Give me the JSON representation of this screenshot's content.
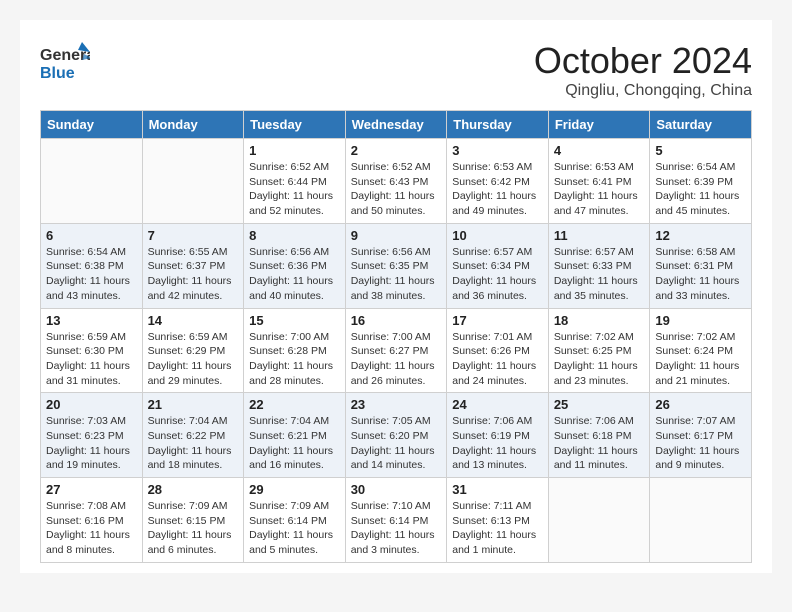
{
  "header": {
    "logo_general": "General",
    "logo_blue": "Blue",
    "month": "October 2024",
    "location": "Qingliu, Chongqing, China"
  },
  "weekdays": [
    "Sunday",
    "Monday",
    "Tuesday",
    "Wednesday",
    "Thursday",
    "Friday",
    "Saturday"
  ],
  "weeks": [
    [
      {
        "day": "",
        "info": ""
      },
      {
        "day": "",
        "info": ""
      },
      {
        "day": "1",
        "info": "Sunrise: 6:52 AM\nSunset: 6:44 PM\nDaylight: 11 hours and 52 minutes."
      },
      {
        "day": "2",
        "info": "Sunrise: 6:52 AM\nSunset: 6:43 PM\nDaylight: 11 hours and 50 minutes."
      },
      {
        "day": "3",
        "info": "Sunrise: 6:53 AM\nSunset: 6:42 PM\nDaylight: 11 hours and 49 minutes."
      },
      {
        "day": "4",
        "info": "Sunrise: 6:53 AM\nSunset: 6:41 PM\nDaylight: 11 hours and 47 minutes."
      },
      {
        "day": "5",
        "info": "Sunrise: 6:54 AM\nSunset: 6:39 PM\nDaylight: 11 hours and 45 minutes."
      }
    ],
    [
      {
        "day": "6",
        "info": "Sunrise: 6:54 AM\nSunset: 6:38 PM\nDaylight: 11 hours and 43 minutes."
      },
      {
        "day": "7",
        "info": "Sunrise: 6:55 AM\nSunset: 6:37 PM\nDaylight: 11 hours and 42 minutes."
      },
      {
        "day": "8",
        "info": "Sunrise: 6:56 AM\nSunset: 6:36 PM\nDaylight: 11 hours and 40 minutes."
      },
      {
        "day": "9",
        "info": "Sunrise: 6:56 AM\nSunset: 6:35 PM\nDaylight: 11 hours and 38 minutes."
      },
      {
        "day": "10",
        "info": "Sunrise: 6:57 AM\nSunset: 6:34 PM\nDaylight: 11 hours and 36 minutes."
      },
      {
        "day": "11",
        "info": "Sunrise: 6:57 AM\nSunset: 6:33 PM\nDaylight: 11 hours and 35 minutes."
      },
      {
        "day": "12",
        "info": "Sunrise: 6:58 AM\nSunset: 6:31 PM\nDaylight: 11 hours and 33 minutes."
      }
    ],
    [
      {
        "day": "13",
        "info": "Sunrise: 6:59 AM\nSunset: 6:30 PM\nDaylight: 11 hours and 31 minutes."
      },
      {
        "day": "14",
        "info": "Sunrise: 6:59 AM\nSunset: 6:29 PM\nDaylight: 11 hours and 29 minutes."
      },
      {
        "day": "15",
        "info": "Sunrise: 7:00 AM\nSunset: 6:28 PM\nDaylight: 11 hours and 28 minutes."
      },
      {
        "day": "16",
        "info": "Sunrise: 7:00 AM\nSunset: 6:27 PM\nDaylight: 11 hours and 26 minutes."
      },
      {
        "day": "17",
        "info": "Sunrise: 7:01 AM\nSunset: 6:26 PM\nDaylight: 11 hours and 24 minutes."
      },
      {
        "day": "18",
        "info": "Sunrise: 7:02 AM\nSunset: 6:25 PM\nDaylight: 11 hours and 23 minutes."
      },
      {
        "day": "19",
        "info": "Sunrise: 7:02 AM\nSunset: 6:24 PM\nDaylight: 11 hours and 21 minutes."
      }
    ],
    [
      {
        "day": "20",
        "info": "Sunrise: 7:03 AM\nSunset: 6:23 PM\nDaylight: 11 hours and 19 minutes."
      },
      {
        "day": "21",
        "info": "Sunrise: 7:04 AM\nSunset: 6:22 PM\nDaylight: 11 hours and 18 minutes."
      },
      {
        "day": "22",
        "info": "Sunrise: 7:04 AM\nSunset: 6:21 PM\nDaylight: 11 hours and 16 minutes."
      },
      {
        "day": "23",
        "info": "Sunrise: 7:05 AM\nSunset: 6:20 PM\nDaylight: 11 hours and 14 minutes."
      },
      {
        "day": "24",
        "info": "Sunrise: 7:06 AM\nSunset: 6:19 PM\nDaylight: 11 hours and 13 minutes."
      },
      {
        "day": "25",
        "info": "Sunrise: 7:06 AM\nSunset: 6:18 PM\nDaylight: 11 hours and 11 minutes."
      },
      {
        "day": "26",
        "info": "Sunrise: 7:07 AM\nSunset: 6:17 PM\nDaylight: 11 hours and 9 minutes."
      }
    ],
    [
      {
        "day": "27",
        "info": "Sunrise: 7:08 AM\nSunset: 6:16 PM\nDaylight: 11 hours and 8 minutes."
      },
      {
        "day": "28",
        "info": "Sunrise: 7:09 AM\nSunset: 6:15 PM\nDaylight: 11 hours and 6 minutes."
      },
      {
        "day": "29",
        "info": "Sunrise: 7:09 AM\nSunset: 6:14 PM\nDaylight: 11 hours and 5 minutes."
      },
      {
        "day": "30",
        "info": "Sunrise: 7:10 AM\nSunset: 6:14 PM\nDaylight: 11 hours and 3 minutes."
      },
      {
        "day": "31",
        "info": "Sunrise: 7:11 AM\nSunset: 6:13 PM\nDaylight: 11 hours and 1 minute."
      },
      {
        "day": "",
        "info": ""
      },
      {
        "day": "",
        "info": ""
      }
    ]
  ]
}
